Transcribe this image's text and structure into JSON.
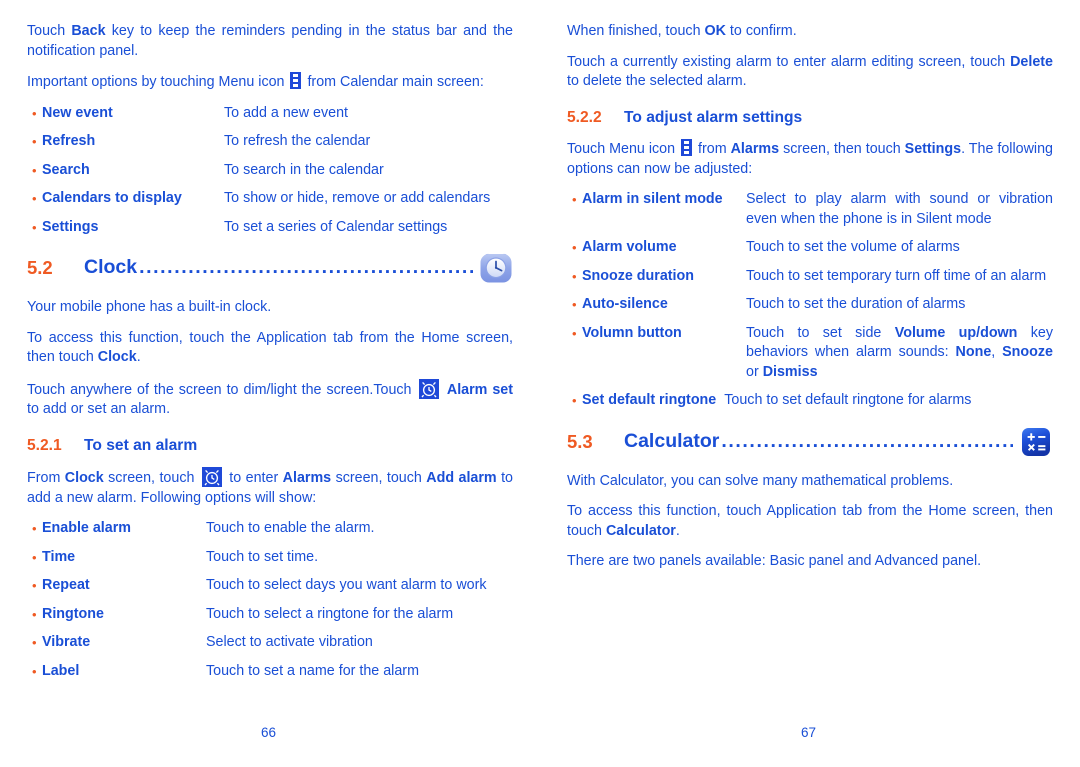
{
  "document": {
    "colors": {
      "body_blue": "#1a4fd6",
      "accent_orange": "#ef5a23",
      "icon_blue": "#1f49d8"
    },
    "left_page_number": "66",
    "right_page_number": "67"
  },
  "left_column": {
    "para_back_key": {
      "t1": "Touch ",
      "b1": "Back",
      "t2": " key to keep the reminders pending in the status bar and the notification panel."
    },
    "para_important_options": {
      "t1": "Important options by touching Menu icon ",
      "icon": "menu-icon",
      "t2": " from Calendar main screen:"
    },
    "calendar_options": [
      {
        "term": "New event",
        "desc": "To add a new event"
      },
      {
        "term": "Refresh",
        "desc": "To refresh the calendar"
      },
      {
        "term": "Search",
        "desc": "To search in the calendar"
      },
      {
        "term": "Calendars to display",
        "desc": "To show or hide, remove or add calendars"
      },
      {
        "term": "Settings",
        "desc": "To set a series of Calendar settings"
      }
    ],
    "section_clock": {
      "number": "5.2",
      "title": "Clock",
      "dots": "..............................................................",
      "icon": "alarm-clock-app-icon"
    },
    "clock_para_1": "Your mobile phone has a built-in clock.",
    "clock_para_2": {
      "t1": "To access this function, touch the Application tab from the Home screen, then touch ",
      "b1": "Clock",
      "t2": "."
    },
    "clock_para_3": {
      "t1": "Touch anywhere of the screen to dim/light the screen.Touch ",
      "icon": "alarm-icon",
      "b1": " Alarm set",
      "t2": " to add or set an alarm."
    },
    "subsection_set_alarm": {
      "number": "5.2.1",
      "title": "To set an alarm"
    },
    "set_alarm_para": {
      "t1": "From ",
      "b1": "Clock",
      "t2": " screen, touch ",
      "icon": "alarm-icon",
      "t3": " to enter ",
      "b2": "Alarms",
      "t4": " screen, touch ",
      "b3": "Add alarm",
      "t5": " to add a new alarm. Following options will show:"
    },
    "alarm_options": [
      {
        "term": "Enable alarm",
        "desc": "Touch to enable the alarm."
      },
      {
        "term": "Time",
        "desc": "Touch to set time."
      },
      {
        "term": "Repeat",
        "desc": "Touch to select days you want alarm to work"
      },
      {
        "term": "Ringtone",
        "desc": "Touch to select a ringtone for the alarm"
      },
      {
        "term": "Vibrate",
        "desc": "Select to activate vibration"
      },
      {
        "term": "Label",
        "desc": "Touch to set a name for the alarm"
      }
    ]
  },
  "right_column": {
    "para_ok": {
      "t1": "When finished, touch ",
      "b1": "OK",
      "t2": " to confirm."
    },
    "para_delete": {
      "t1": "Touch a currently existing alarm to enter alarm editing screen, touch ",
      "b1": "Delete",
      "t2": " to delete the selected alarm."
    },
    "subsection_adjust_alarm": {
      "number": "5.2.2",
      "title": "To adjust alarm settings"
    },
    "adjust_para": {
      "t1": "Touch Menu icon ",
      "icon": "menu-icon",
      "t2": " from ",
      "b1": "Alarms",
      "t3": " screen, then touch ",
      "b2": "Settings",
      "t4": ". The following options can now be adjusted:"
    },
    "settings_options": [
      {
        "term": "Alarm in silent mode",
        "desc": "Select to play alarm with sound or vibration even when the phone is in Silent mode"
      },
      {
        "term": "Alarm volume",
        "desc": "Touch to set the volume of alarms"
      },
      {
        "term": "Snooze duration",
        "desc": "Touch to set temporary turn off time of an alarm"
      },
      {
        "term": "Auto-silence",
        "desc": "Touch to set the duration of alarms"
      }
    ],
    "volumn_button": {
      "term": "Volumn button",
      "d1": "Touch to set side ",
      "b1": "Volume up/down",
      "d2": " key behaviors when alarm sounds: ",
      "b2": "None",
      "d3": ", ",
      "b3": "Snooze",
      "d4": " or ",
      "b4": "Dismiss"
    },
    "set_default_ringtone": {
      "term": "Set default ringtone",
      "desc": "Touch to set default ringtone for alarms"
    },
    "section_calculator": {
      "number": "5.3",
      "title": "Calculator",
      "dots": "......................................................",
      "icon": "calculator-app-icon"
    },
    "calc_para_1": "With Calculator, you can solve many mathematical problems.",
    "calc_para_2": {
      "t1": "To access this function, touch Application tab from the Home screen, then touch ",
      "b1": "Calculator",
      "t2": "."
    },
    "calc_para_3": "There are two panels available: Basic panel and Advanced panel."
  }
}
